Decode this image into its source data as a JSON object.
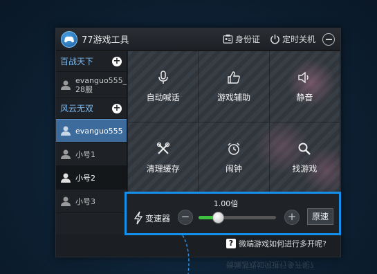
{
  "window": {
    "title": "77游戏工具",
    "id_card_label": "身份证",
    "shutdown_label": "定时关机"
  },
  "sidebar": {
    "groups": [
      {
        "name": "百战天下",
        "accounts": [
          {
            "line1": "evanguo555_",
            "line2": "28服"
          }
        ]
      },
      {
        "name": "风云无双",
        "accounts": [
          {
            "label": "evanguo555"
          },
          {
            "label": "小号1"
          },
          {
            "label": "小号2"
          },
          {
            "label": "小号3"
          }
        ]
      }
    ]
  },
  "tiles": [
    {
      "label": "自动喊话",
      "icon": "microphone-icon"
    },
    {
      "label": "游戏辅助",
      "icon": "thumbs-up-icon"
    },
    {
      "label": "静音",
      "icon": "speaker-icon"
    },
    {
      "label": "清理缓存",
      "icon": "tools-icon"
    },
    {
      "label": "闹钟",
      "icon": "alarm-clock-icon"
    },
    {
      "label": "找游戏",
      "icon": "search-icon"
    }
  ],
  "speed": {
    "value_text": "1.00倍",
    "label": "变速器",
    "minus": "−",
    "plus": "+",
    "reset_label": "原速",
    "level": 0.25
  },
  "help": {
    "icon_text": "?",
    "text": "微端游戏如何进行多开呢?"
  },
  "colors": {
    "accent": "#1590ea",
    "selected_row": "#3c6b9c",
    "slider_fill": "#3fc23f",
    "group_text": "#7db9ef"
  }
}
